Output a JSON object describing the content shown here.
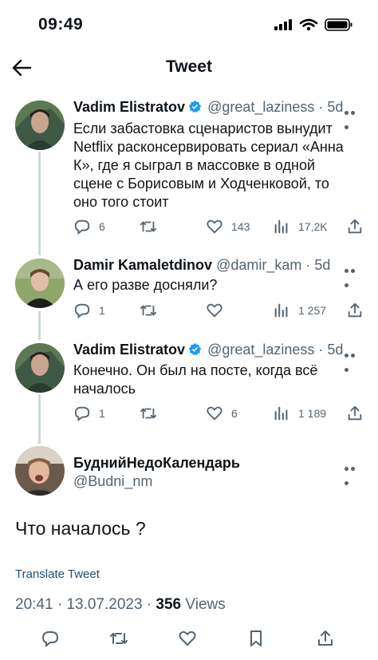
{
  "status_bar": {
    "time": "09:49"
  },
  "header": {
    "title": "Tweet"
  },
  "tweets": [
    {
      "name": "Vadim Elistratov",
      "handle": "@great_laziness",
      "time": "5d",
      "text": "Если забастовка сценаристов вынудит Netflix расконсервировать сериал «Анна К», где я сыграл в массовке в одной сцене с Борисовым и Ходченковой, то оно того стоит",
      "replies": "6",
      "retweets": "",
      "likes": "143",
      "views": "17,2K"
    },
    {
      "name": "Damir Kamaletdinov",
      "handle": "@damir_kam",
      "time": "5d",
      "text": "А его разве досняли?",
      "replies": "1",
      "retweets": "",
      "likes": "",
      "views": "1 257"
    },
    {
      "name": "Vadim Elistratov",
      "handle": "@great_laziness",
      "time": "5d",
      "text": "Конечно. Он был на посте, когда всё началось",
      "replies": "1",
      "retweets": "",
      "likes": "6",
      "views": "1 189"
    }
  ],
  "main_tweet": {
    "name": "БуднийНедоКалендарь",
    "handle": "@Budni_nm",
    "text": "Что началось ?",
    "translate_label": "Translate Tweet",
    "timestamp": "20:41 · 13.07.2023 ·",
    "views_count": "356",
    "views_label": "Views"
  },
  "icons": {
    "reply": "reply-icon",
    "retweet": "retweet-icon",
    "like": "heart-icon",
    "views": "views-chart-icon",
    "share": "share-icon",
    "bookmark": "bookmark-icon",
    "more": "more-dots-icon",
    "verified": "verified-badge-icon"
  },
  "colors": {
    "verified": "#1d9bf0",
    "muted": "#536471",
    "link": "#1d4f7a"
  }
}
